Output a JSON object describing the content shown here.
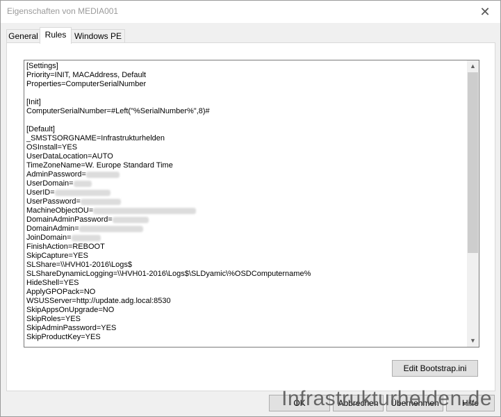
{
  "window": {
    "title": "Eigenschaften von MEDIA001"
  },
  "tabs": [
    {
      "label": "General",
      "active": false
    },
    {
      "label": "Rules",
      "active": true
    },
    {
      "label": "Windows PE",
      "active": false
    }
  ],
  "rules": {
    "lines": [
      "[Settings]",
      "Priority=INIT, MACAddress, Default",
      "Properties=ComputerSerialNumber",
      "",
      "[Init]",
      "ComputerSerialNumber=#Left(\"%SerialNumber%\",8)#",
      "",
      "[Default]",
      "_SMSTSORGNAME=Infrastrukturhelden",
      "OSInstall=YES",
      "UserDataLocation=AUTO",
      "TimeZoneName=W. Europe Standard Time",
      "AdminPassword=",
      "UserDomain=",
      "UserID=",
      "UserPassword=",
      "MachineObjectOU=",
      "DomainAdminPassword=",
      "DomainAdmin=",
      "JoinDomain=",
      "FinishAction=REBOOT",
      "SkipCapture=YES",
      "SLShare=\\\\HVH01-2016\\Logs$",
      "SLShareDynamicLogging=\\\\HVH01-2016\\Logs$\\SLDyamic\\%OSDComputername%",
      "HideShell=YES",
      "ApplyGPOPack=NO",
      "WSUSServer=http://update.adg.local:8530",
      "SkipAppsOnUpgrade=NO",
      "SkipRoles=YES",
      "SkipAdminPassword=YES",
      "SkipProductKey=YES"
    ]
  },
  "buttons": {
    "edit_bootstrap": "Edit Bootstrap.ini",
    "ok": "OK",
    "cancel": "Abbrechen",
    "apply": "Übernehmen",
    "help": "Hilfe"
  },
  "watermark": "Infrastrukturhelden.de"
}
